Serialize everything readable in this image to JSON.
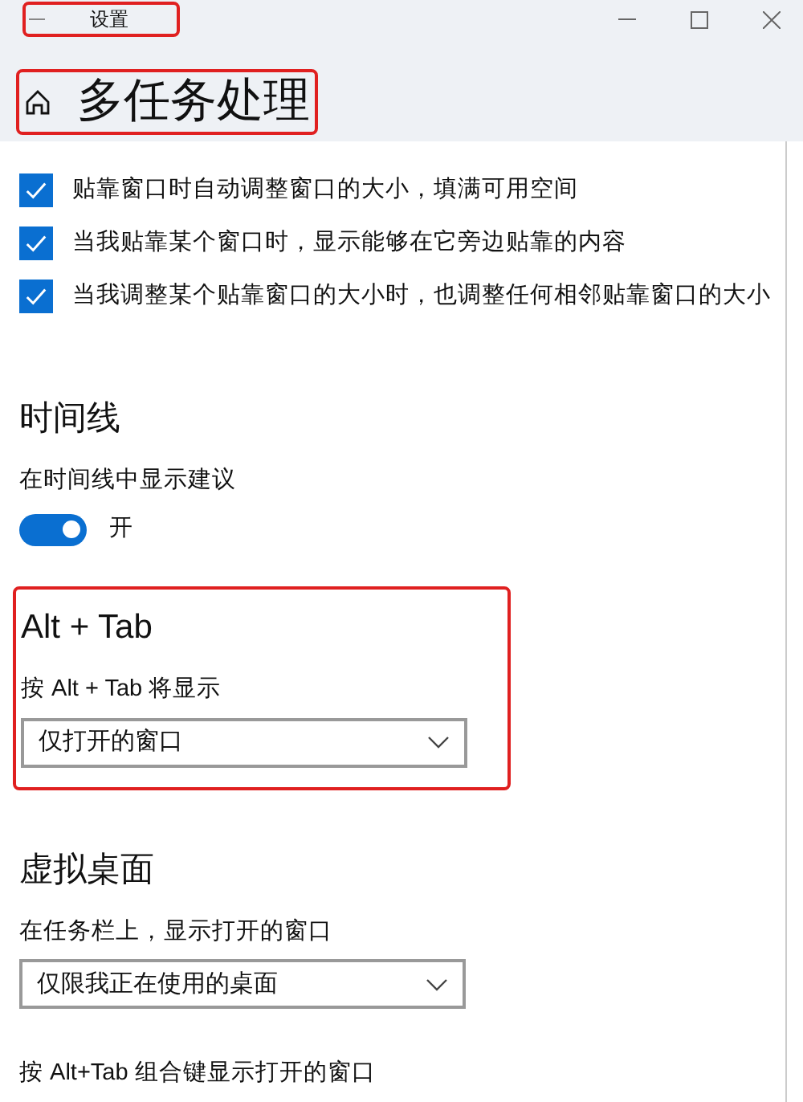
{
  "window": {
    "title": "设置",
    "highlighted": true
  },
  "header": {
    "title": "多任务处理",
    "highlighted": true
  },
  "snap_options": [
    {
      "label": "贴靠窗口时自动调整窗口的大小，填满可用空间",
      "checked": true
    },
    {
      "label": "当我贴靠某个窗口时，显示能够在它旁边贴靠的内容",
      "checked": true
    },
    {
      "label": "当我调整某个贴靠窗口的大小时，也调整任何相邻贴靠窗口的大小",
      "checked": true
    }
  ],
  "sections": [
    {
      "kind": "toggle",
      "heading": "时间线",
      "highlighted": false,
      "label": "在时间线中显示建议",
      "on": true,
      "state_text": "开"
    },
    {
      "kind": "dropdown",
      "heading": "Alt + Tab",
      "highlighted": true,
      "label": "按 Alt + Tab 将显示",
      "value": "仅打开的窗口"
    },
    {
      "kind": "dropdown",
      "heading": "虚拟桌面",
      "highlighted": false,
      "label": "在任务栏上，显示打开的窗口",
      "value": "仅限我正在使用的桌面"
    },
    {
      "kind": "label",
      "highlighted": false,
      "label": "按 Alt+Tab 组合键显示打开的窗口"
    }
  ]
}
